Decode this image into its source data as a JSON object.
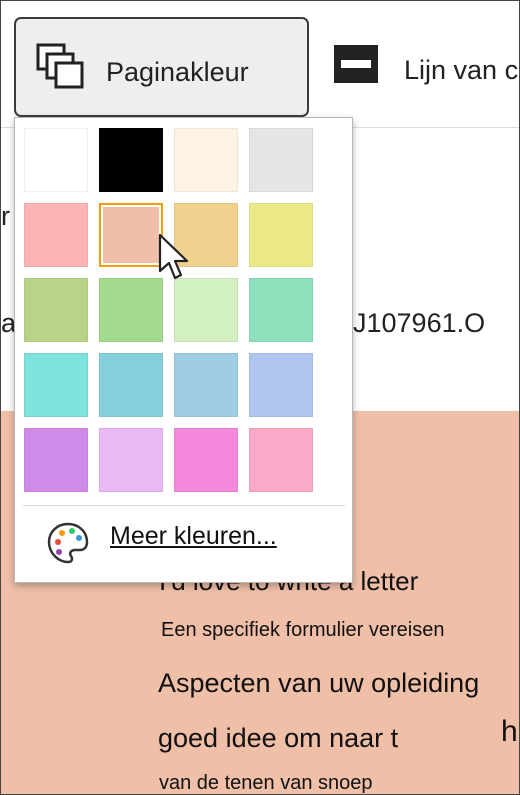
{
  "ribbon": {
    "page_color_label": "Paginakleur",
    "line_label": "Lijn van c"
  },
  "background": {
    "fragment_left_1": "r",
    "fragment_left_2": "a",
    "fragment_right": "J107961.O",
    "fragment_far_right": "h",
    "lines": [
      "I'd love to write a letter",
      "Een specifiek formulier vereisen",
      "Aspecten van uw opleiding",
      "goed idee om naar t",
      "van de tenen van snoep"
    ]
  },
  "dropdown": {
    "swatches": [
      {
        "name": "white",
        "color": "#ffffff"
      },
      {
        "name": "black",
        "color": "#000000"
      },
      {
        "name": "cream",
        "color": "#fdf3e5"
      },
      {
        "name": "light-gray",
        "color": "#e6e6e6"
      },
      {
        "name": "pink",
        "color": "#fbb4b4"
      },
      {
        "name": "peach",
        "color": "#f0bfa8",
        "selected": true
      },
      {
        "name": "tan",
        "color": "#f0d28e"
      },
      {
        "name": "yellow",
        "color": "#ebe986"
      },
      {
        "name": "olive-green",
        "color": "#b8d486"
      },
      {
        "name": "green",
        "color": "#a4da8e"
      },
      {
        "name": "mint",
        "color": "#d2f0c1"
      },
      {
        "name": "sea-green",
        "color": "#8ee0bc"
      },
      {
        "name": "turquoise",
        "color": "#7ee2de"
      },
      {
        "name": "teal",
        "color": "#86d0dc"
      },
      {
        "name": "sky-blue",
        "color": "#a0cce4"
      },
      {
        "name": "periwinkle",
        "color": "#b0c6ee"
      },
      {
        "name": "violet",
        "color": "#d08ae8"
      },
      {
        "name": "lavender",
        "color": "#eab8f4"
      },
      {
        "name": "magenta",
        "color": "#f488dc"
      },
      {
        "name": "rose",
        "color": "#f9aac8"
      }
    ],
    "more_colors_label": "Meer kleuren..."
  },
  "colors": {
    "selection_border": "#f39c12",
    "document_background": "#f0bfa8"
  }
}
